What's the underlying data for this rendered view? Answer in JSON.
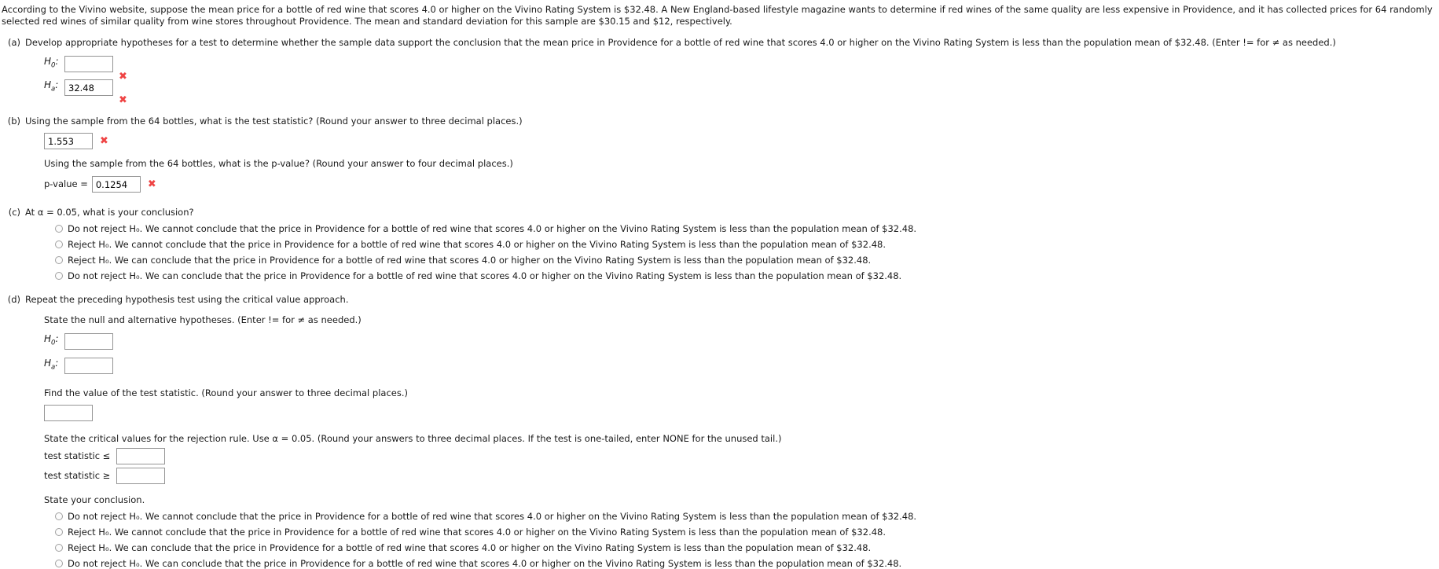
{
  "intro": {
    "text": "According to the Vivino website, suppose the mean price for a bottle of red wine that scores 4.0 or higher on the Vivino Rating System is $32.48. A New England-based lifestyle magazine wants to determine if red wines of the same quality are less expensive in Providence, and it has collected prices for 64 randomly selected red wines of similar quality from wine stores throughout Providence. The mean and standard deviation for this sample are $30.15 and $12, respectively."
  },
  "colors": {
    "wrong_mark": "#ef4444",
    "input_border": "#959595",
    "text": "#1a1a1a"
  },
  "parts": {
    "a": {
      "label": "(a)",
      "question": "Develop appropriate hypotheses for a test to determine whether the sample data support the conclusion that the mean price in Providence for a bottle of red wine that scores 4.0 or higher on the Vivino Rating System is less than the population mean of $32.48. (Enter != for ≠ as needed.)",
      "h0_label": "H",
      "h0_sub": "0",
      "h0_colon": ":",
      "h0_value": "",
      "ha_label": "H",
      "ha_sub": "a",
      "ha_colon": ":",
      "ha_value": "32.48",
      "wrong_mark": "✖"
    },
    "b": {
      "label": "(b)",
      "question_statistic": "Using the sample from the 64 bottles, what is the test statistic? (Round your answer to three decimal places.)",
      "statistic_value": "1.553",
      "question_pvalue": "Using the sample from the 64 bottles, what is the p-value? (Round your answer to four decimal places.)",
      "pvalue_label": "p-value =",
      "pvalue_value": "0.1254",
      "wrong_mark": "✖"
    },
    "c": {
      "label": "(c)",
      "question": "At α = 0.05, what is your conclusion?",
      "options": [
        "Do not reject H₀. We cannot conclude that the price in Providence for a bottle of red wine that scores 4.0 or higher on the Vivino Rating System is less than the population mean of $32.48.",
        "Reject H₀. We cannot conclude that the price in Providence for a bottle of red wine that scores 4.0 or higher on the Vivino Rating System is less than the population mean of $32.48.",
        "Reject H₀. We can conclude that the price in Providence for a bottle of red wine that scores 4.0 or higher on the Vivino Rating System is less than the population mean of $32.48.",
        "Do not reject H₀. We can conclude that the price in Providence for a bottle of red wine that scores 4.0 or higher on the Vivino Rating System is less than the population mean of $32.48."
      ]
    },
    "d": {
      "label": "(d)",
      "question": "Repeat the preceding hypothesis test using the critical value approach.",
      "state_hypotheses": "State the null and alternative hypotheses. (Enter != for ≠ as needed.)",
      "h0_label": "H",
      "h0_sub": "0",
      "h0_colon": ":",
      "h0_value": "",
      "ha_label": "H",
      "ha_sub": "a",
      "ha_colon": ":",
      "ha_value": "",
      "find_statistic": "Find the value of the test statistic. (Round your answer to three decimal places.)",
      "statistic_value": "",
      "critical_intro": "State the critical values for the rejection rule. Use α = 0.05. (Round your answers to three decimal places. If the test is one-tailed, enter NONE for the unused tail.)",
      "crit_lower_label": "test statistic ≤",
      "crit_lower_value": "",
      "crit_upper_label": "test statistic ≥",
      "crit_upper_value": "",
      "state_conclusion": "State your conclusion.",
      "options": [
        "Do not reject H₀. We cannot conclude that the price in Providence for a bottle of red wine that scores 4.0 or higher on the Vivino Rating System is less than the population mean of $32.48.",
        "Reject H₀. We cannot conclude that the price in Providence for a bottle of red wine that scores 4.0 or higher on the Vivino Rating System is less than the population mean of $32.48.",
        "Reject H₀. We can conclude that the price in Providence for a bottle of red wine that scores 4.0 or higher on the Vivino Rating System is less than the population mean of $32.48.",
        "Do not reject H₀. We can conclude that the price in Providence for a bottle of red wine that scores 4.0 or higher on the Vivino Rating System is less than the population mean of $32.48."
      ]
    }
  }
}
